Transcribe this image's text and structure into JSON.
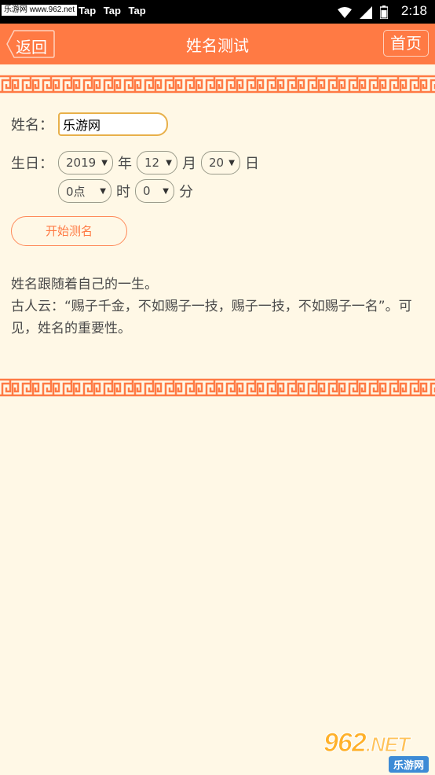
{
  "status_bar": {
    "watermark": "乐游网 www.962.net",
    "notifications": "Tap  Tap  Tap",
    "time": "2:18"
  },
  "app_bar": {
    "back_label": "返回",
    "title": "姓名测试",
    "home_label": "首页"
  },
  "form": {
    "name_label": "姓名：",
    "name_value": "乐游网",
    "birth_label": "生日：",
    "year": "2019",
    "year_unit": "年",
    "month": "12",
    "month_unit": "月",
    "day": "20",
    "day_unit": "日",
    "hour": "0点",
    "hour_unit": "时",
    "minute": "0",
    "minute_unit": "分",
    "submit_label": "开始测名"
  },
  "description": {
    "line1": "姓名跟随着自己的一生。",
    "line2": "古人云：“赐子千金，不如赐子一技，赐子一技，不如赐子一名”。可见，姓名的重要性。"
  },
  "watermark_logo": {
    "top": "962",
    "net": ".NET",
    "bottom": "乐游网"
  },
  "colors": {
    "accent": "#ff7a44",
    "background": "#fff8e6"
  }
}
